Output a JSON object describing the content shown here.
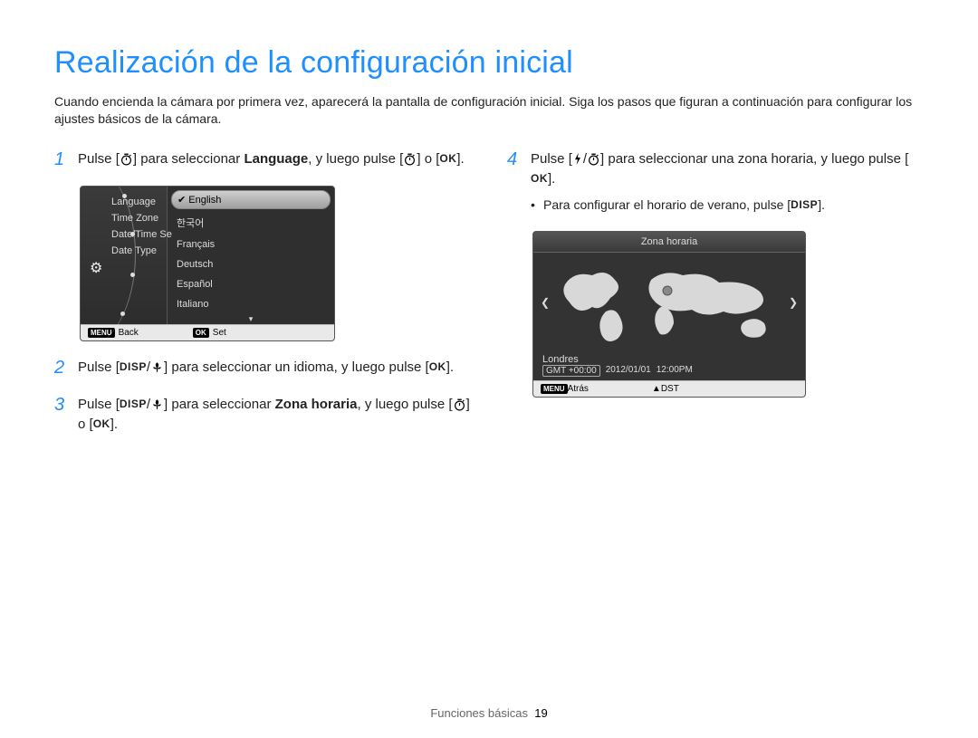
{
  "title": "Realización de la configuración inicial",
  "intro": "Cuando encienda la cámara por primera vez, aparecerá la pantalla de configuración inicial. Siga los pasos que figuran a continuación para configurar los ajustes básicos de la cámara.",
  "steps": {
    "s1": {
      "num": "1",
      "pre": "Pulse [",
      "mid": "] para seleccionar ",
      "bold": "Language",
      "post": ", y luego pulse [",
      "tail_mid": "] o [",
      "tail_end": "]."
    },
    "s2": {
      "num": "2",
      "pre": "Pulse [",
      "mid": "] para seleccionar un idioma, y luego pulse [",
      "end": "]."
    },
    "s3": {
      "num": "3",
      "pre": "Pulse [",
      "mid": "] para seleccionar ",
      "bold": "Zona horaria",
      "post": ", y luego pulse [",
      "tail_mid": "] o [",
      "tail_end": "]."
    },
    "s4": {
      "num": "4",
      "pre": "Pulse [",
      "mid": "] para seleccionar una zona horaria, y luego pulse [",
      "end": "].",
      "sub_pre": "Para configurar el horario de verano, pulse [",
      "sub_end": "]."
    }
  },
  "labels": {
    "disp": "DISP",
    "ok": "OK",
    "menu": "MENU"
  },
  "lcd1": {
    "menu": [
      "Language",
      "Time Zone",
      "Date/Time Se",
      "Date Type"
    ],
    "langs_selected": "English",
    "langs": [
      "한국어",
      "Français",
      "Deutsch",
      "Español",
      "Italiano"
    ],
    "footer_back": "Back",
    "footer_set": "Set"
  },
  "lcd2": {
    "title": "Zona horaria",
    "city": "Londres",
    "gmt": "GMT +00:00",
    "date": "2012/01/01",
    "time": "12:00PM",
    "footer_back": "Atrás",
    "footer_dst": "DST"
  },
  "footer": {
    "section": "Funciones básicas",
    "page": "19"
  }
}
